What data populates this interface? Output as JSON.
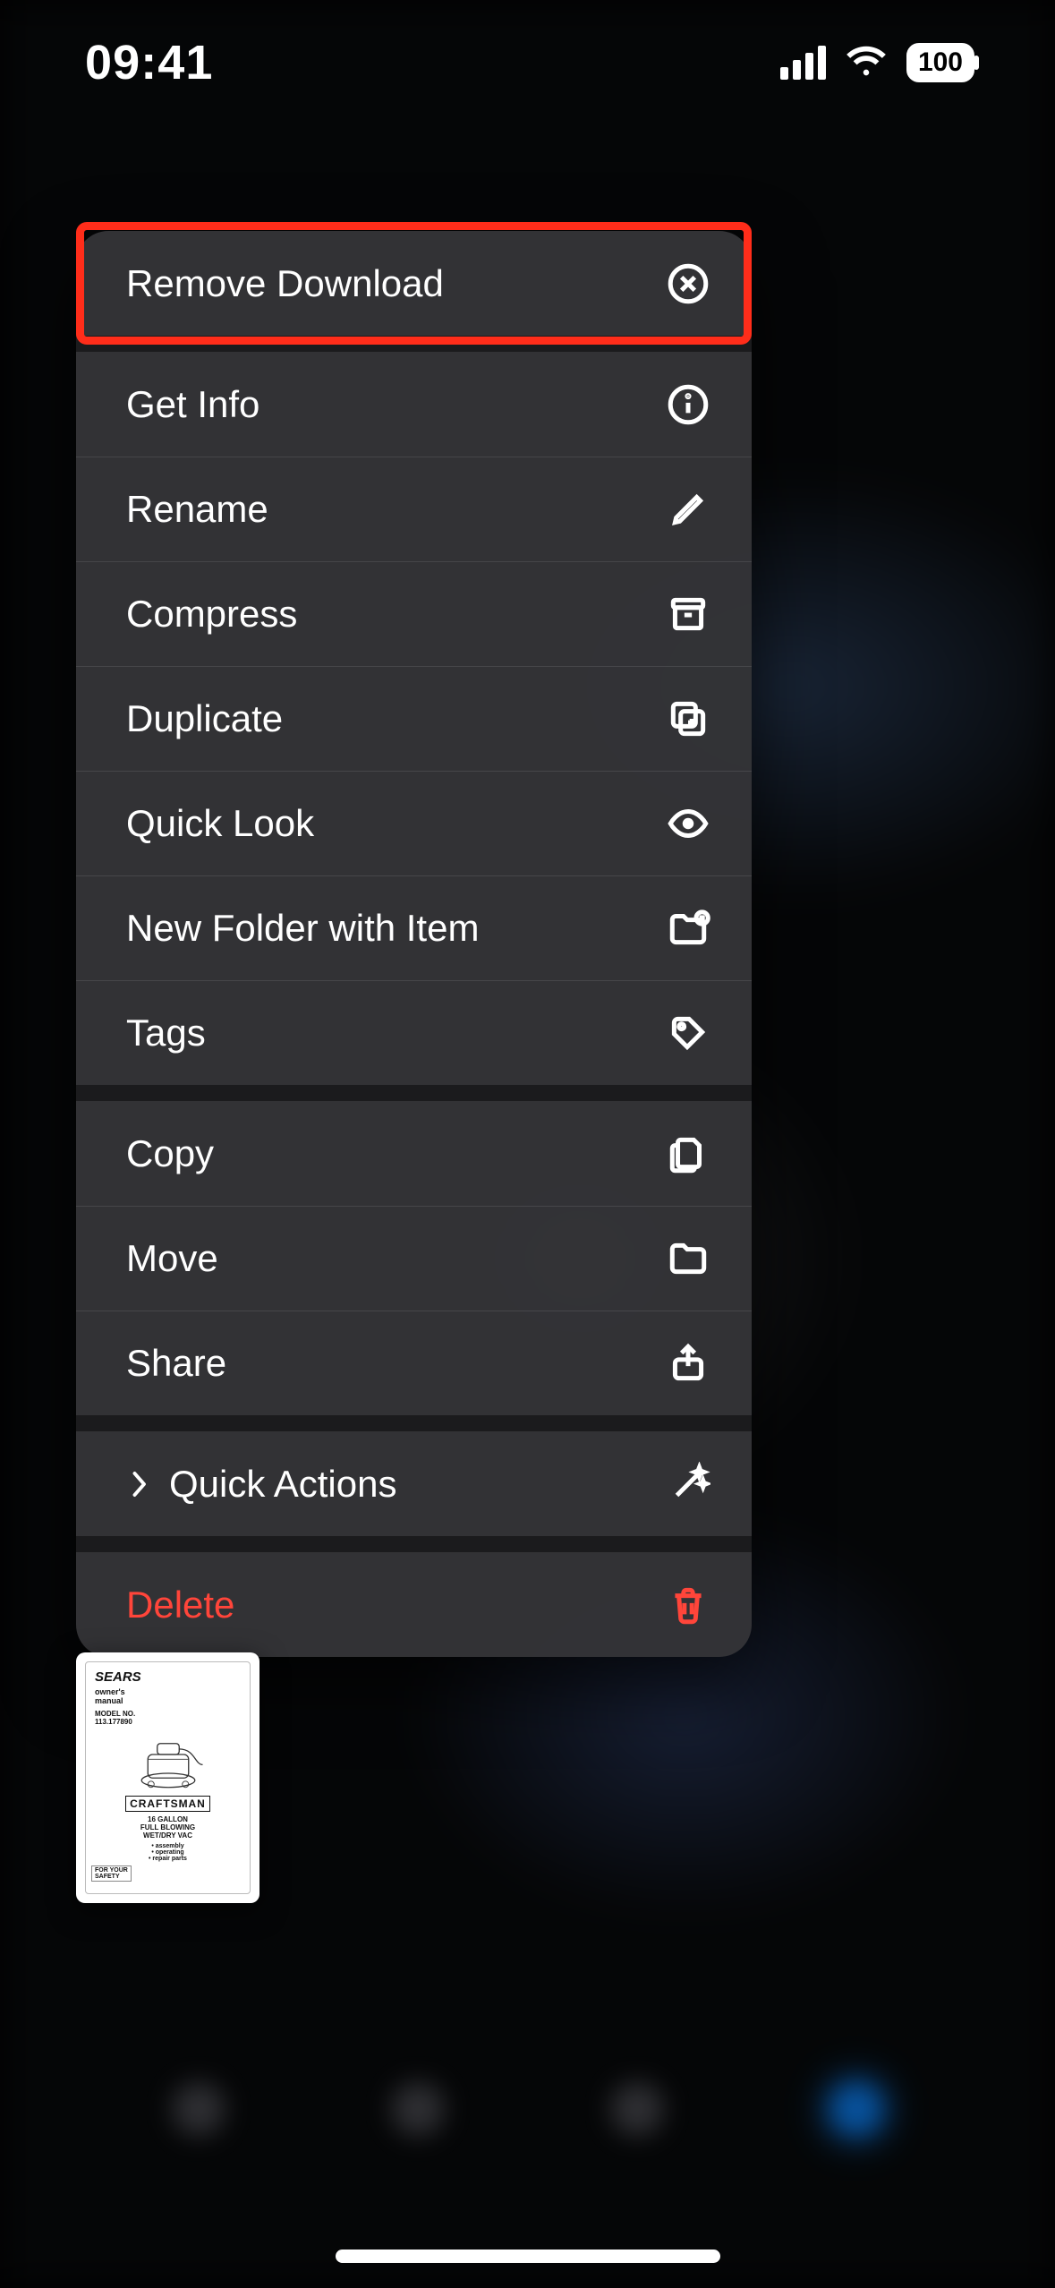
{
  "statusbar": {
    "time": "09:41",
    "battery": "100"
  },
  "menu": {
    "groups": [
      [
        {
          "id": "remove-download",
          "label": "Remove Download",
          "icon": "x-circle"
        }
      ],
      [
        {
          "id": "get-info",
          "label": "Get Info",
          "icon": "info-circle"
        },
        {
          "id": "rename",
          "label": "Rename",
          "icon": "pencil"
        },
        {
          "id": "compress",
          "label": "Compress",
          "icon": "archive"
        },
        {
          "id": "duplicate",
          "label": "Duplicate",
          "icon": "duplicate"
        },
        {
          "id": "quick-look",
          "label": "Quick Look",
          "icon": "eye"
        },
        {
          "id": "new-folder-with-item",
          "label": "New Folder with Item",
          "icon": "folder-plus"
        },
        {
          "id": "tags",
          "label": "Tags",
          "icon": "tag"
        }
      ],
      [
        {
          "id": "copy",
          "label": "Copy",
          "icon": "copy"
        },
        {
          "id": "move",
          "label": "Move",
          "icon": "folder"
        },
        {
          "id": "share",
          "label": "Share",
          "icon": "share"
        }
      ],
      [
        {
          "id": "quick-actions",
          "label": "Quick Actions",
          "icon": "wand",
          "submenu": true
        }
      ],
      [
        {
          "id": "delete",
          "label": "Delete",
          "icon": "trash",
          "destructive": true
        }
      ]
    ]
  },
  "thumbnail": {
    "brand_top": "SEARS",
    "owner_line": "owner's\nmanual",
    "model": "113.177890",
    "brand": "CRAFTSMAN",
    "desc": "16 GALLON\nFULL BLOWING\nWET/DRY VAC",
    "list": "• assembly\n• operating\n• repair parts",
    "safety": "FOR YOUR\nSAFETY"
  }
}
